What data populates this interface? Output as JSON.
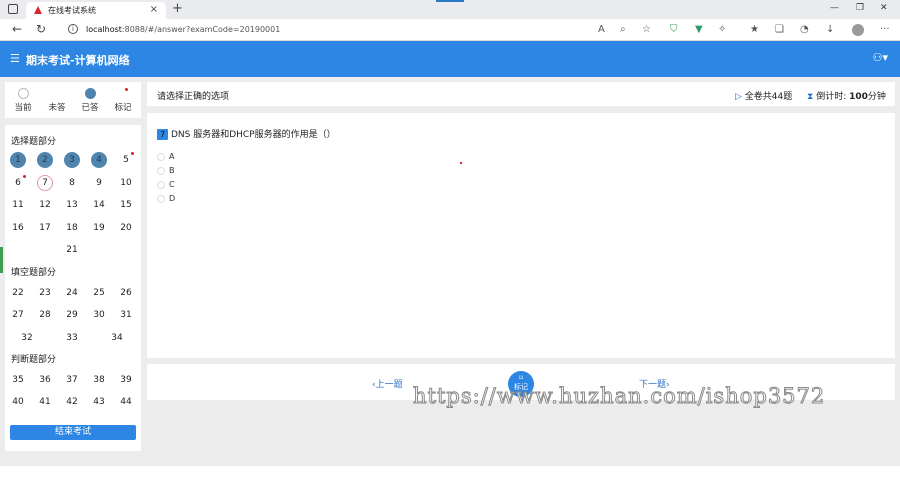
{
  "browser": {
    "tab_title": "在线考试系统",
    "url_host": "localhost",
    "url_rest": ":8088/#/answer?examCode=20190001",
    "icons": [
      "warning-icon",
      "info-icon"
    ]
  },
  "header": {
    "title": "期末考试-计算机网络"
  },
  "legend": [
    {
      "label": "当前"
    },
    {
      "label": "未答"
    },
    {
      "label": "已答"
    },
    {
      "label": "标记"
    }
  ],
  "sections": {
    "choice": {
      "title": "选择题部分"
    },
    "fill": {
      "title": "填空题部分"
    },
    "judge": {
      "title": "判断题部分"
    }
  },
  "questions": {
    "choice": [
      "1",
      "2",
      "3",
      "4",
      "5",
      "6",
      "7",
      "8",
      "9",
      "10",
      "11",
      "12",
      "13",
      "14",
      "15",
      "16",
      "17",
      "18",
      "19",
      "20",
      "21"
    ],
    "fill": [
      "22",
      "23",
      "24",
      "25",
      "26",
      "27",
      "28",
      "29",
      "30",
      "31",
      "32",
      "33",
      "34"
    ],
    "judge": [
      "35",
      "36",
      "37",
      "38",
      "39",
      "40",
      "41",
      "42",
      "43",
      "44"
    ]
  },
  "end_exam": "结束考试",
  "topbar": {
    "hint": "请选择正确的选项",
    "total": "全卷共44题",
    "countdown_label": "倒计时:",
    "countdown_value": "100",
    "countdown_unit": "分钟"
  },
  "question": {
    "number": "7",
    "text": "DNS 服务器和DHCP服务器的作用是（）",
    "options": [
      "A",
      "B",
      "C",
      "D"
    ]
  },
  "nav": {
    "prev": "上一题",
    "next": "下一题",
    "mark": "标记"
  },
  "watermark": "https://www.huzhan.com/ishop3572"
}
